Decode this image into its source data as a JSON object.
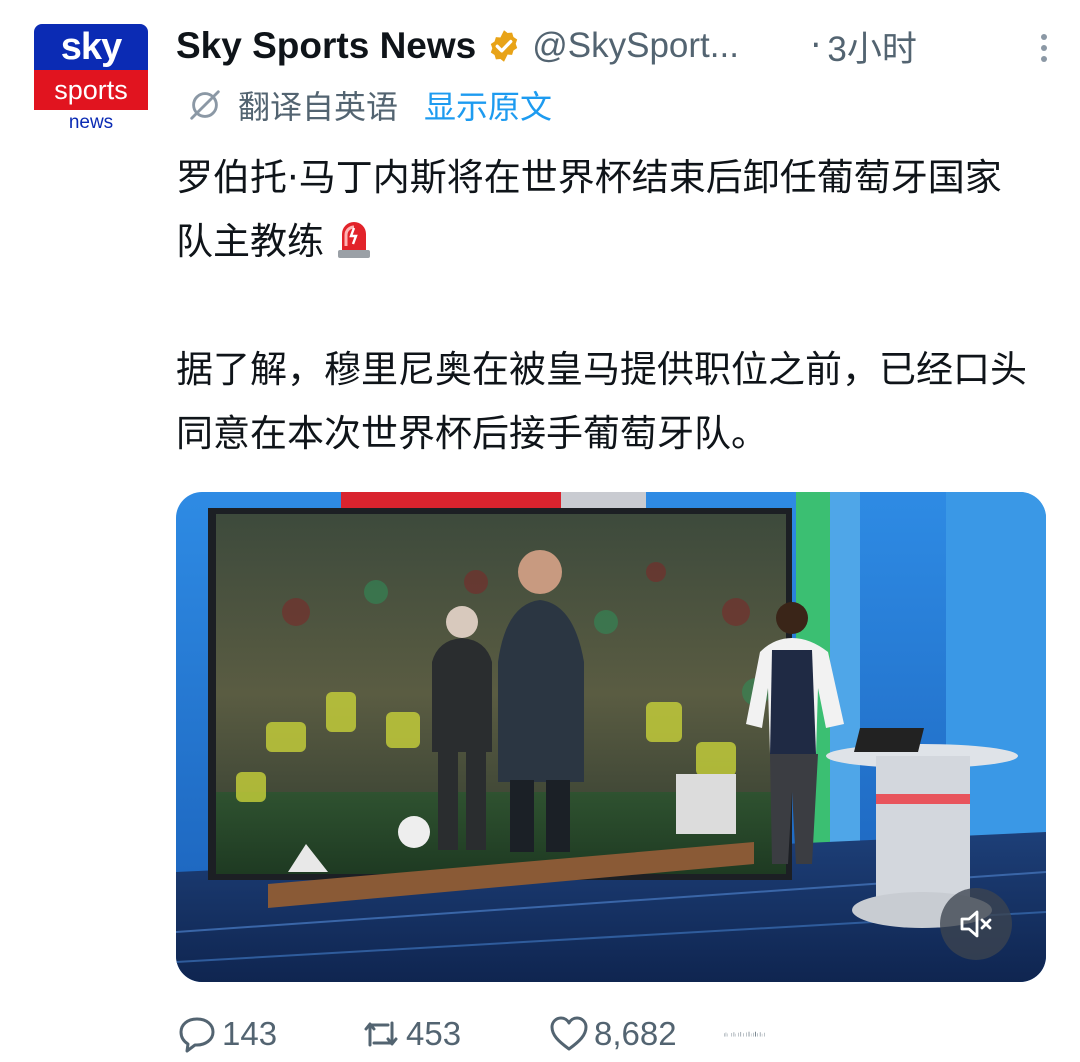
{
  "avatar": {
    "logo_line1": "sky",
    "logo_line2": "sports",
    "logo_line3": "news"
  },
  "header": {
    "display_name": "Sky Sports News",
    "handle": "@SkySport...",
    "separator": "·",
    "time": "3小时",
    "more_icon": "more-vertical-icon"
  },
  "translation": {
    "label": "翻译自英语",
    "show_original": "显示原文",
    "icon": "globe-icon"
  },
  "tweet": {
    "paragraph1": "罗伯托·马丁内斯将在世界杯结束后卸任葡萄牙国家队主教练",
    "paragraph2": "据了解，穆里尼奥在被皇马提供职位之前，已经口头同意在本次世界杯后接手葡萄牙队。",
    "emoji": "siren-emoji"
  },
  "media": {
    "type": "video",
    "mute_icon": "volume-muted-icon"
  },
  "actions": {
    "replies": "143",
    "retweets": "453",
    "likes": "8,682"
  },
  "colors": {
    "accent": "#1d9bf0",
    "secondary_text": "#536471",
    "verified": "#e8a317"
  }
}
